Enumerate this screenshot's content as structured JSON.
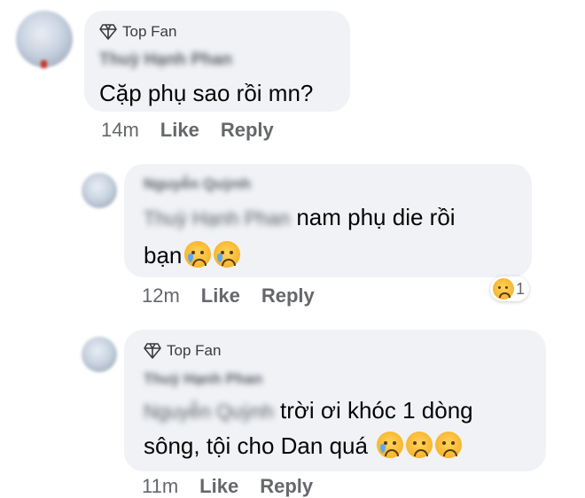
{
  "comments": [
    {
      "badge": "Top Fan",
      "author": "Thuỳ Hạnh Phan",
      "text": "Cặp phụ sao rồi mn?",
      "time": "14m",
      "like": "Like",
      "reply": "Reply"
    },
    {
      "author": "Nguyễn Quỳnh",
      "tag": "Thuỳ Hạnh Phan",
      "text_line1": " nam phụ die rồi",
      "text_line2": "bạn",
      "emojis": [
        "sad-tear-emoji",
        "sad-tear-emoji"
      ],
      "time": "12m",
      "like": "Like",
      "reply": "Reply",
      "reaction_count": "1"
    },
    {
      "badge": "Top Fan",
      "author": "Thuỳ Hạnh Phan",
      "tag": "Nguyễn Quỳnh",
      "text_line1": " trời ơi khóc 1 dòng",
      "text_line2": "sông, tội cho Dan quá ",
      "emojis": [
        "sad-tear-emoji",
        "sad-emoji",
        "sad-emoji"
      ],
      "time": "11m",
      "like": "Like",
      "reply": "Reply"
    }
  ]
}
